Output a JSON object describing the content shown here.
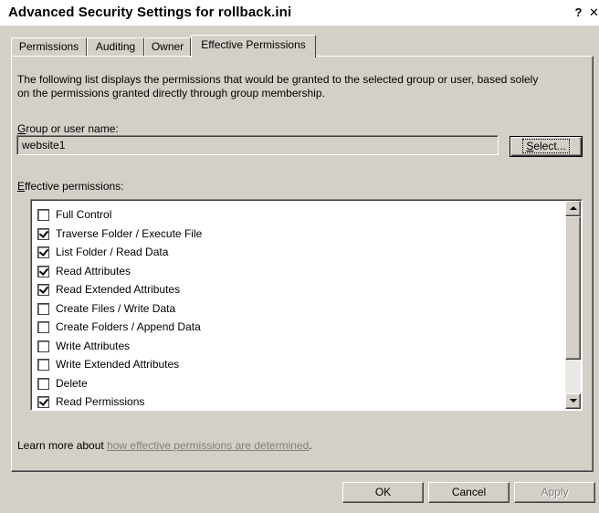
{
  "window": {
    "title": "Advanced Security Settings for rollback.ini",
    "help_label": "?",
    "close_label": "✕"
  },
  "tabs": [
    {
      "label": "Permissions",
      "active": false
    },
    {
      "label": "Auditing",
      "active": false
    },
    {
      "label": "Owner",
      "active": false
    },
    {
      "label": "Effective Permissions",
      "active": true
    }
  ],
  "panel": {
    "description_line1": "The following list displays the permissions that would be granted to the selected group or user, based solely",
    "description_line2": "on the permissions granted directly through group membership.",
    "group_label_accel": "G",
    "group_label_rest": "roup or user name:",
    "group_value": "website1",
    "select_button_accel": "S",
    "select_button_rest": "elect...",
    "effective_label_accel": "E",
    "effective_label_rest": "ffective permissions:",
    "permissions": [
      {
        "label": "Full Control",
        "checked": false
      },
      {
        "label": "Traverse Folder / Execute File",
        "checked": true
      },
      {
        "label": "List Folder / Read Data",
        "checked": true
      },
      {
        "label": "Read Attributes",
        "checked": true
      },
      {
        "label": "Read Extended Attributes",
        "checked": true
      },
      {
        "label": "Create Files / Write Data",
        "checked": false
      },
      {
        "label": "Create Folders / Append Data",
        "checked": false
      },
      {
        "label": "Write Attributes",
        "checked": false
      },
      {
        "label": "Write Extended Attributes",
        "checked": false
      },
      {
        "label": "Delete",
        "checked": false
      },
      {
        "label": "Read Permissions",
        "checked": true
      }
    ],
    "learn_prefix": "Learn more about ",
    "learn_link": "how effective permissions are determined",
    "learn_suffix": "."
  },
  "footer": {
    "ok_label": "OK",
    "cancel_label": "Cancel",
    "apply_label": "Apply"
  },
  "icons": {
    "scroll_up": "up-arrow-icon",
    "scroll_down": "down-arrow-icon",
    "checkbox_checked": "checkmark-icon"
  }
}
